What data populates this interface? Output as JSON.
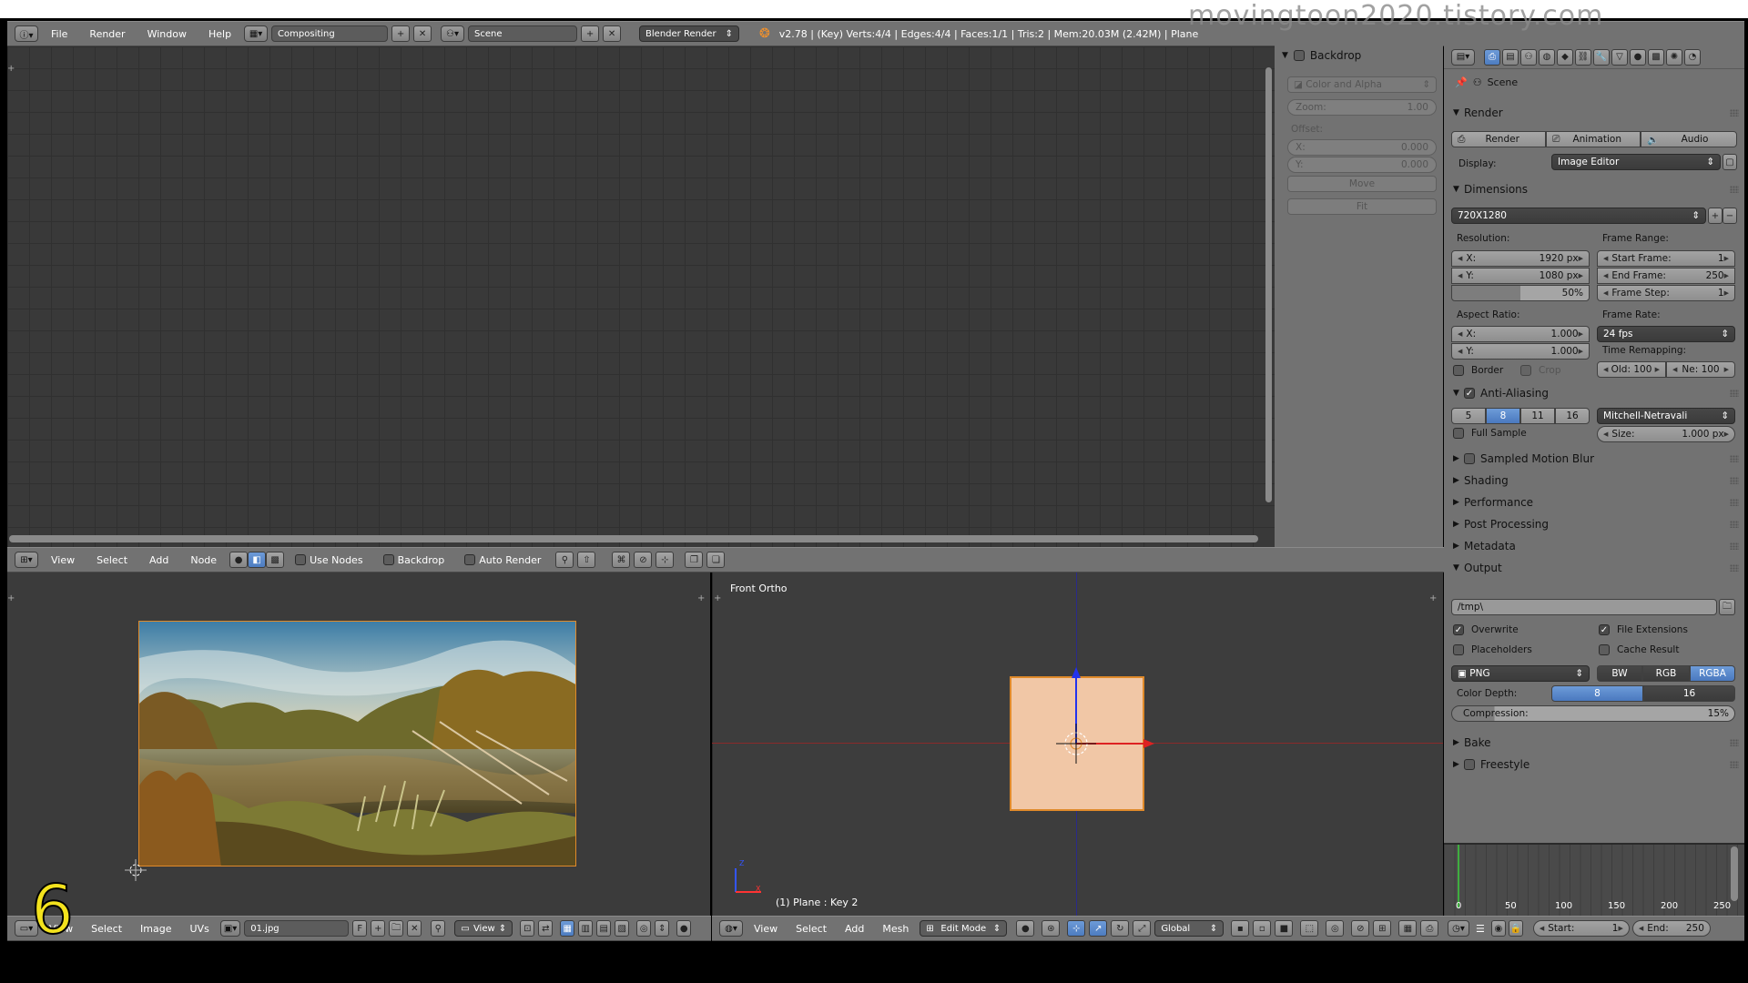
{
  "watermark": "movingtoon2020.tistory.com",
  "episode_number": "6",
  "top_header": {
    "menus": [
      "File",
      "Render",
      "Window",
      "Help"
    ],
    "screen_layout": "Compositing",
    "scene": "Scene",
    "engine": "Blender Render",
    "stats": "v2.78 | (Key) Verts:4/4 | Edges:4/4 | Faces:1/1 | Tris:2 | Mem:20.03M (2.42M) | Plane"
  },
  "node_editor": {
    "header_menus": [
      "View",
      "Select",
      "Add",
      "Node"
    ],
    "use_nodes_label": "Use Nodes",
    "backdrop_label": "Backdrop",
    "auto_render_label": "Auto Render"
  },
  "backdrop_panel": {
    "title": "Backdrop",
    "channels": "Color and Alpha",
    "zoom_label": "Zoom:",
    "zoom_value": "1.00",
    "offset_label": "Offset:",
    "x_label": "X:",
    "x_value": "0.000",
    "y_label": "Y:",
    "y_value": "0.000",
    "move_label": "Move",
    "fit_label": "Fit"
  },
  "image_editor": {
    "header_menus": [
      "View",
      "Select",
      "Image",
      "UVs"
    ],
    "image_name": "01.jpg",
    "fake_user": "F",
    "view_label": "View"
  },
  "viewport": {
    "view_name": "Front Ortho",
    "object_info": "(1) Plane : Key 2",
    "header_menus": [
      "View",
      "Select",
      "Add",
      "Mesh"
    ],
    "mode": "Edit Mode",
    "orientation": "Global",
    "axis_z": "Z",
    "axis_x": "X"
  },
  "properties": {
    "context": "Scene",
    "render": {
      "title": "Render",
      "buttons": [
        "Render",
        "Animation",
        "Audio"
      ],
      "display_label": "Display:",
      "display_value": "Image Editor"
    },
    "dimensions": {
      "title": "Dimensions",
      "preset": "720X1280",
      "resolution_label": "Resolution:",
      "res_x": {
        "label": "X:",
        "value": "1920 px"
      },
      "res_y": {
        "label": "Y:",
        "value": "1080 px"
      },
      "res_pct": "50%",
      "frame_range_label": "Frame Range:",
      "start_frame": {
        "label": "Start Frame:",
        "value": "1"
      },
      "end_frame": {
        "label": "End Frame:",
        "value": "250"
      },
      "frame_step": {
        "label": "Frame Step:",
        "value": "1"
      },
      "aspect_label": "Aspect Ratio:",
      "asp_x": {
        "label": "X:",
        "value": "1.000"
      },
      "asp_y": {
        "label": "Y:",
        "value": "1.000"
      },
      "frame_rate_label": "Frame Rate:",
      "frame_rate": "24 fps",
      "time_remap_label": "Time Remapping:",
      "old": "Old: 100",
      "new": "Ne:  100",
      "border_label": "Border",
      "crop_label": "Crop"
    },
    "anti_aliasing": {
      "title": "Anti-Aliasing",
      "samples": [
        "5",
        "8",
        "11",
        "16"
      ],
      "selected_sample": "8",
      "filter": "Mitchell-Netravali",
      "full_sample_label": "Full Sample",
      "size": {
        "label": "Size:",
        "value": "1.000 px"
      }
    },
    "collapsed_sections": [
      "Sampled Motion Blur",
      "Shading",
      "Performance",
      "Post Processing",
      "Metadata"
    ],
    "output": {
      "title": "Output",
      "path": "/tmp\\",
      "overwrite_label": "Overwrite",
      "file_extensions_label": "File Extensions",
      "placeholders_label": "Placeholders",
      "cache_result_label": "Cache Result",
      "format": "PNG",
      "color_modes": [
        "BW",
        "RGB",
        "RGBA"
      ],
      "color_mode_selected": "RGBA",
      "color_depth_label": "Color Depth:",
      "color_depths": [
        "8",
        "16"
      ],
      "color_depth_selected": "8",
      "compression": {
        "label": "Compression:",
        "value": "15%"
      }
    },
    "bake_label": "Bake",
    "freestyle_label": "Freestyle"
  },
  "timeline": {
    "ticks": [
      "0",
      "50",
      "100",
      "150",
      "200",
      "250"
    ],
    "start": {
      "label": "Start:",
      "value": "1"
    },
    "end": {
      "label": "End:",
      "value": "250"
    }
  },
  "colors": {
    "accent": "#5680c2",
    "panel": "#727272",
    "grid_bg": "#393939",
    "plane_fill": "#f1c7a6",
    "selection_outline": "#e08a2a"
  }
}
